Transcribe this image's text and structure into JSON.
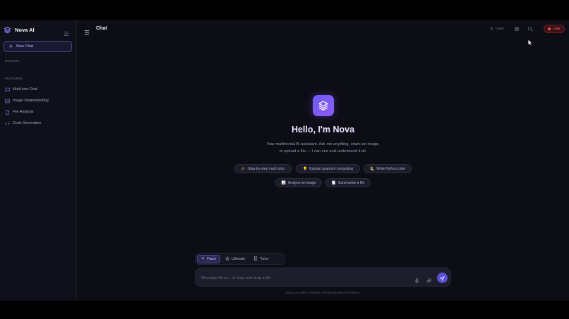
{
  "app": {
    "name": "Nova AI",
    "accent": "#7c5cf6",
    "live_color": "#ff4d4d"
  },
  "sidebar": {
    "new_chat_label": "New Chat",
    "history_label": "HISTORY",
    "features_label": "FEATURES",
    "features": [
      {
        "label": "Multi-turn Chat",
        "icon": "chat-icon"
      },
      {
        "label": "Image Understanding",
        "icon": "image-icon"
      },
      {
        "label": "File Analysis",
        "icon": "file-icon"
      },
      {
        "label": "Code Generation",
        "icon": "code-icon"
      }
    ]
  },
  "header": {
    "title": "Chat",
    "clear_label": "Clear",
    "live_label": "Live"
  },
  "hero": {
    "title": "Hello, I'm Nova",
    "subtitle_line1": "Your multimodal AI assistant. Ask me anything, share an image,",
    "subtitle_line2": "or upload a file — I can see and understand it all."
  },
  "suggestions": [
    {
      "emoji": "🎓",
      "label": "Step-by-step math tutor"
    },
    {
      "emoji": "💡",
      "label": "Explain quantum computing"
    },
    {
      "emoji": "🐍",
      "label": "Write Python code"
    },
    {
      "emoji": "📊",
      "label": "Analyse an image"
    },
    {
      "emoji": "📄",
      "label": "Summarise a file"
    }
  ],
  "modes": [
    {
      "label": "Flash",
      "active": true
    },
    {
      "label": "Ultimate",
      "active": false
    },
    {
      "label": "Tutor",
      "active": false
    }
  ],
  "composer": {
    "placeholder": "Message Nova... or drag and drop a file",
    "value": ""
  },
  "disclaimer": "Nova can make mistakes. Verify important information."
}
